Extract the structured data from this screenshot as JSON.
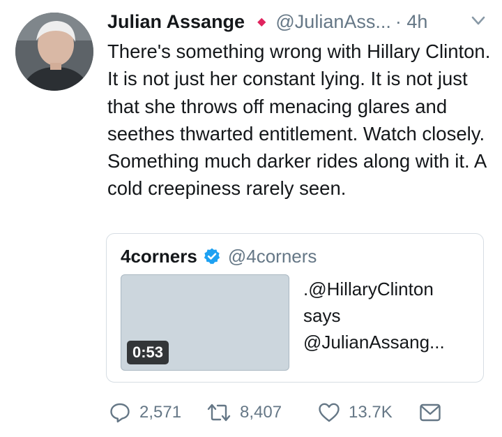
{
  "tweet": {
    "author_name": "Julian Assange",
    "handle": "@JulianAss...",
    "time": "· 4h",
    "text": "There's something wrong with Hillary Clinton. It is not just her constant lying. It is not just that she throws off menacing glares and seethes thwarted entitlement. Watch closely. Something much darker rides along with it. A cold creepiness rarely seen."
  },
  "quoted": {
    "author_name": "4corners",
    "handle": "@4corners",
    "video_duration": "0:53",
    "text": ".@HillaryClinton\nsays\n@JulianAssang..."
  },
  "actions": {
    "replies": "2,571",
    "retweets": "8,407",
    "likes": "13.7K"
  },
  "icons": {
    "reply": "reply-icon",
    "retweet": "retweet-icon",
    "like": "heart-icon",
    "dm": "envelope-icon",
    "verified": "verified-badge-icon",
    "caret": "chevron-down-icon",
    "badge": "diamond-icon"
  },
  "colors": {
    "badge": "#e0245e",
    "verified": "#1da1f2",
    "muted": "#657786",
    "thumbnail": "#ccd6dd"
  }
}
